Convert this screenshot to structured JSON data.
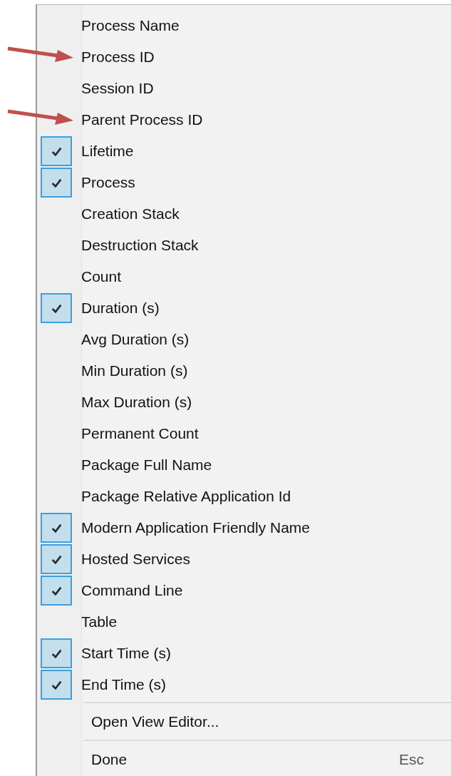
{
  "menu": {
    "items": [
      {
        "kind": "check",
        "label": "Process Name",
        "checked": false,
        "marked": false
      },
      {
        "kind": "check",
        "label": "Process ID",
        "checked": false,
        "marked": true
      },
      {
        "kind": "check",
        "label": "Session ID",
        "checked": false,
        "marked": false
      },
      {
        "kind": "check",
        "label": "Parent Process ID",
        "checked": false,
        "marked": true
      },
      {
        "kind": "check",
        "label": "Lifetime",
        "checked": true,
        "marked": false
      },
      {
        "kind": "check",
        "label": "Process",
        "checked": true,
        "marked": false
      },
      {
        "kind": "check",
        "label": "Creation Stack",
        "checked": false,
        "marked": false
      },
      {
        "kind": "check",
        "label": "Destruction Stack",
        "checked": false,
        "marked": false
      },
      {
        "kind": "check",
        "label": "Count",
        "checked": false,
        "marked": false
      },
      {
        "kind": "check",
        "label": "Duration (s)",
        "checked": true,
        "marked": false
      },
      {
        "kind": "check",
        "label": "Avg Duration (s)",
        "checked": false,
        "marked": false
      },
      {
        "kind": "check",
        "label": "Min Duration (s)",
        "checked": false,
        "marked": false
      },
      {
        "kind": "check",
        "label": "Max Duration (s)",
        "checked": false,
        "marked": false
      },
      {
        "kind": "check",
        "label": "Permanent Count",
        "checked": false,
        "marked": false
      },
      {
        "kind": "check",
        "label": "Package Full Name",
        "checked": false,
        "marked": false
      },
      {
        "kind": "check",
        "label": "Package Relative Application Id",
        "checked": false,
        "marked": false
      },
      {
        "kind": "check",
        "label": "Modern Application Friendly Name",
        "checked": true,
        "marked": false
      },
      {
        "kind": "check",
        "label": "Hosted Services",
        "checked": true,
        "marked": false
      },
      {
        "kind": "check",
        "label": "Command Line",
        "checked": true,
        "marked": false
      },
      {
        "kind": "check",
        "label": "Table",
        "checked": false,
        "marked": false
      },
      {
        "kind": "check",
        "label": "Start Time (s)",
        "checked": true,
        "marked": false
      },
      {
        "kind": "check",
        "label": "End Time (s)",
        "checked": true,
        "marked": false
      },
      {
        "kind": "separator"
      },
      {
        "kind": "command",
        "label": "Open View Editor..."
      },
      {
        "kind": "separator"
      },
      {
        "kind": "command",
        "label": "Done",
        "shortcut": "Esc"
      }
    ]
  }
}
